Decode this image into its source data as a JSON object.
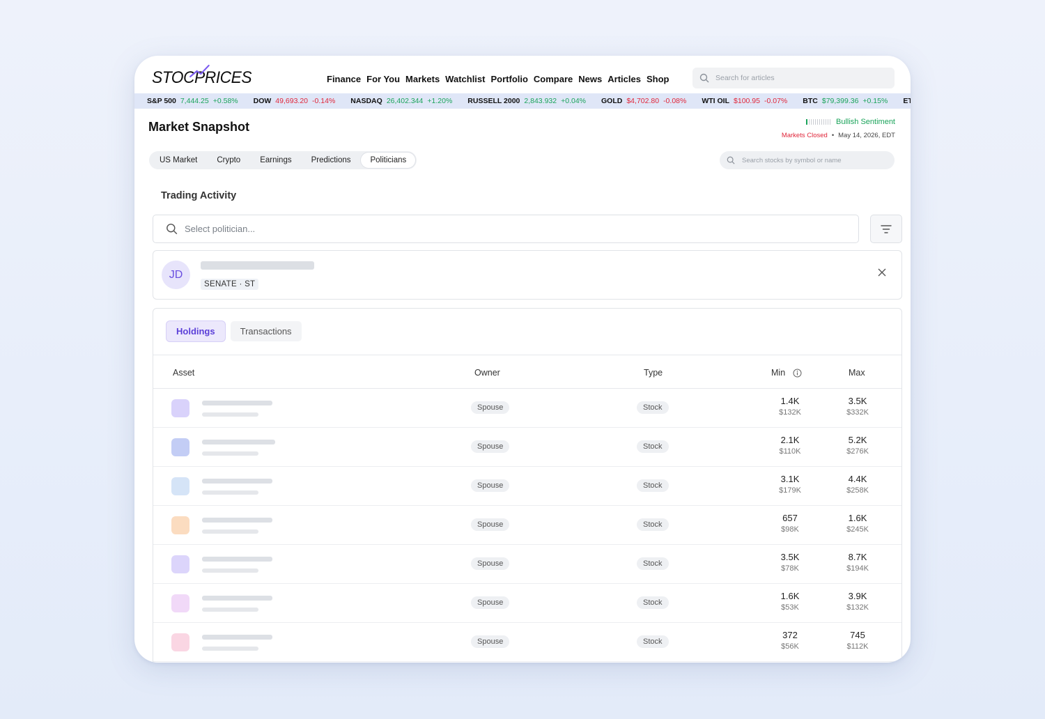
{
  "logo": {
    "text_left": "STOC",
    "text_right": "PRICES"
  },
  "nav": [
    "Finance",
    "For You",
    "Markets",
    "Watchlist",
    "Portfolio",
    "Compare",
    "News",
    "Articles",
    "Shop"
  ],
  "top_search": {
    "placeholder": "Search for articles"
  },
  "ticker": [
    {
      "symbol": "S&P 500",
      "value": "7,444.25",
      "change": "+0.58%",
      "dir": "up"
    },
    {
      "symbol": "DOW",
      "value": "49,693.20",
      "change": "-0.14%",
      "dir": "down"
    },
    {
      "symbol": "NASDAQ",
      "value": "26,402.344",
      "change": "+1.20%",
      "dir": "up"
    },
    {
      "symbol": "RUSSELL 2000",
      "value": "2,843.932",
      "change": "+0.04%",
      "dir": "up"
    },
    {
      "symbol": "GOLD",
      "value": "$4,702.80",
      "change": "-0.08%",
      "dir": "down"
    },
    {
      "symbol": "WTI OIL",
      "value": "$100.95",
      "change": "-0.07%",
      "dir": "down"
    },
    {
      "symbol": "BTC",
      "value": "$79,399.36",
      "change": "+0.15%",
      "dir": "up"
    },
    {
      "symbol": "ETH",
      "value": "$",
      "change": "",
      "dir": "down"
    }
  ],
  "snapshot": {
    "title": "Market Snapshot",
    "sentiment": "Bullish Sentiment",
    "market_status": "Markets Closed",
    "date": "May 14, 2026, EDT",
    "tabs": [
      "US Market",
      "Crypto",
      "Earnings",
      "Predictions",
      "Politicians"
    ],
    "active_tab": "Politicians",
    "stock_search_placeholder": "Search stocks by symbol or name"
  },
  "trading": {
    "title": "Trading Activity",
    "politician_placeholder": "Select politician...",
    "politician": {
      "initials": "JD",
      "chamber": "SENATE · ST"
    },
    "subtabs": [
      "Holdings",
      "Transactions"
    ],
    "active_subtab": "Holdings",
    "columns": {
      "asset": "Asset",
      "owner": "Owner",
      "type": "Type",
      "min": "Min",
      "max": "Max"
    },
    "rows": [
      {
        "owner": "Spouse",
        "type": "Stock",
        "min_shares": "1.4K",
        "min_value": "$132K",
        "max_shares": "3.5K",
        "max_value": "$332K",
        "color": "#d9d2fb"
      },
      {
        "owner": "Spouse",
        "type": "Stock",
        "min_shares": "2.1K",
        "min_value": "$110K",
        "max_shares": "5.2K",
        "max_value": "$276K",
        "color": "#c3cdf5"
      },
      {
        "owner": "Spouse",
        "type": "Stock",
        "min_shares": "3.1K",
        "min_value": "$179K",
        "max_shares": "4.4K",
        "max_value": "$258K",
        "color": "#d5e4f7"
      },
      {
        "owner": "Spouse",
        "type": "Stock",
        "min_shares": "657",
        "min_value": "$98K",
        "max_shares": "1.6K",
        "max_value": "$245K",
        "color": "#fbdcc0"
      },
      {
        "owner": "Spouse",
        "type": "Stock",
        "min_shares": "3.5K",
        "min_value": "$78K",
        "max_shares": "8.7K",
        "max_value": "$194K",
        "color": "#dcd5fb"
      },
      {
        "owner": "Spouse",
        "type": "Stock",
        "min_shares": "1.6K",
        "min_value": "$53K",
        "max_shares": "3.9K",
        "max_value": "$132K",
        "color": "#f1d9f8"
      },
      {
        "owner": "Spouse",
        "type": "Stock",
        "min_shares": "372",
        "min_value": "$56K",
        "max_shares": "745",
        "max_value": "$112K",
        "color": "#fad6e3"
      }
    ]
  }
}
